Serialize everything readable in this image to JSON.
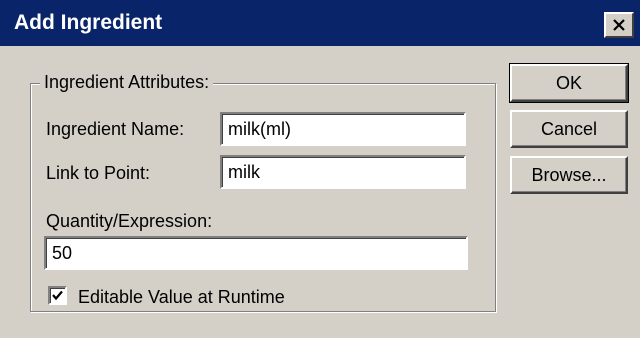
{
  "window": {
    "title": "Add Ingredient",
    "close_symbol": "close-icon"
  },
  "group": {
    "legend": "Ingredient Attributes:"
  },
  "fields": {
    "ingredient_name_label": "Ingredient Name:",
    "ingredient_name_value": "milk(ml)",
    "link_to_point_label": "Link to Point:",
    "link_to_point_value": "milk",
    "quantity_label": "Quantity/Expression:",
    "quantity_value": "50"
  },
  "checkbox": {
    "label": "Editable Value at Runtime",
    "checked": true
  },
  "buttons": {
    "ok": "OK",
    "cancel": "Cancel",
    "browse": "Browse..."
  },
  "colors": {
    "titlebar": "#0a246a",
    "face": "#d4d0c8"
  }
}
